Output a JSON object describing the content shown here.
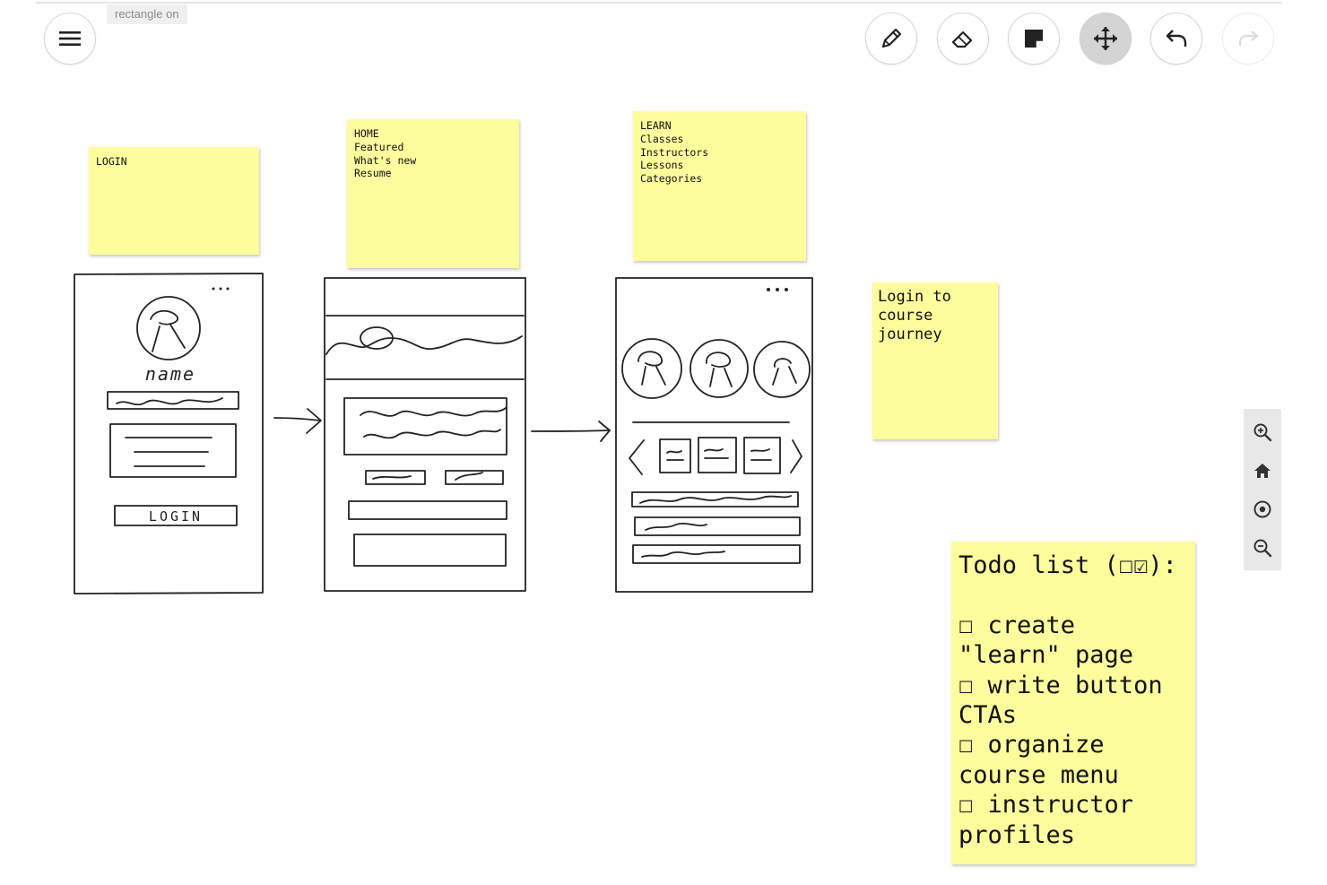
{
  "toolbar": {
    "menu_icon": "hamburger-menu-icon",
    "tooltip": "rectangle on",
    "tools": [
      {
        "name": "pen",
        "icon": "pencil-icon"
      },
      {
        "name": "eraser",
        "icon": "eraser-icon"
      },
      {
        "name": "sticky-note",
        "icon": "sticky-note-icon"
      },
      {
        "name": "move",
        "icon": "move-arrows-icon",
        "active": true
      },
      {
        "name": "undo",
        "icon": "undo-icon"
      },
      {
        "name": "redo",
        "icon": "redo-icon",
        "disabled": true
      }
    ]
  },
  "notes": {
    "login": "LOGIN",
    "home": "HOME\nFeatured\nWhat's new\nResume",
    "learn": "LEARN\nClasses\nInstructors\nLessons\nCategories",
    "journey": "Login to\ncourse\njourney",
    "todo": "Todo list (☐☑):\n\n☐ create \"learn\" page\n☐ write button CTAs\n☐ organize course menu\n☐ instructor profiles"
  },
  "sketches": {
    "login_name": "name",
    "login_button": "LOGIN"
  },
  "zoom_controls": [
    "zoom-in-icon",
    "home-icon",
    "center-target-icon",
    "zoom-out-icon"
  ],
  "colors": {
    "sticky": "#fdfd9d",
    "active_tool": "#d4d4d4",
    "ink": "#222222"
  }
}
